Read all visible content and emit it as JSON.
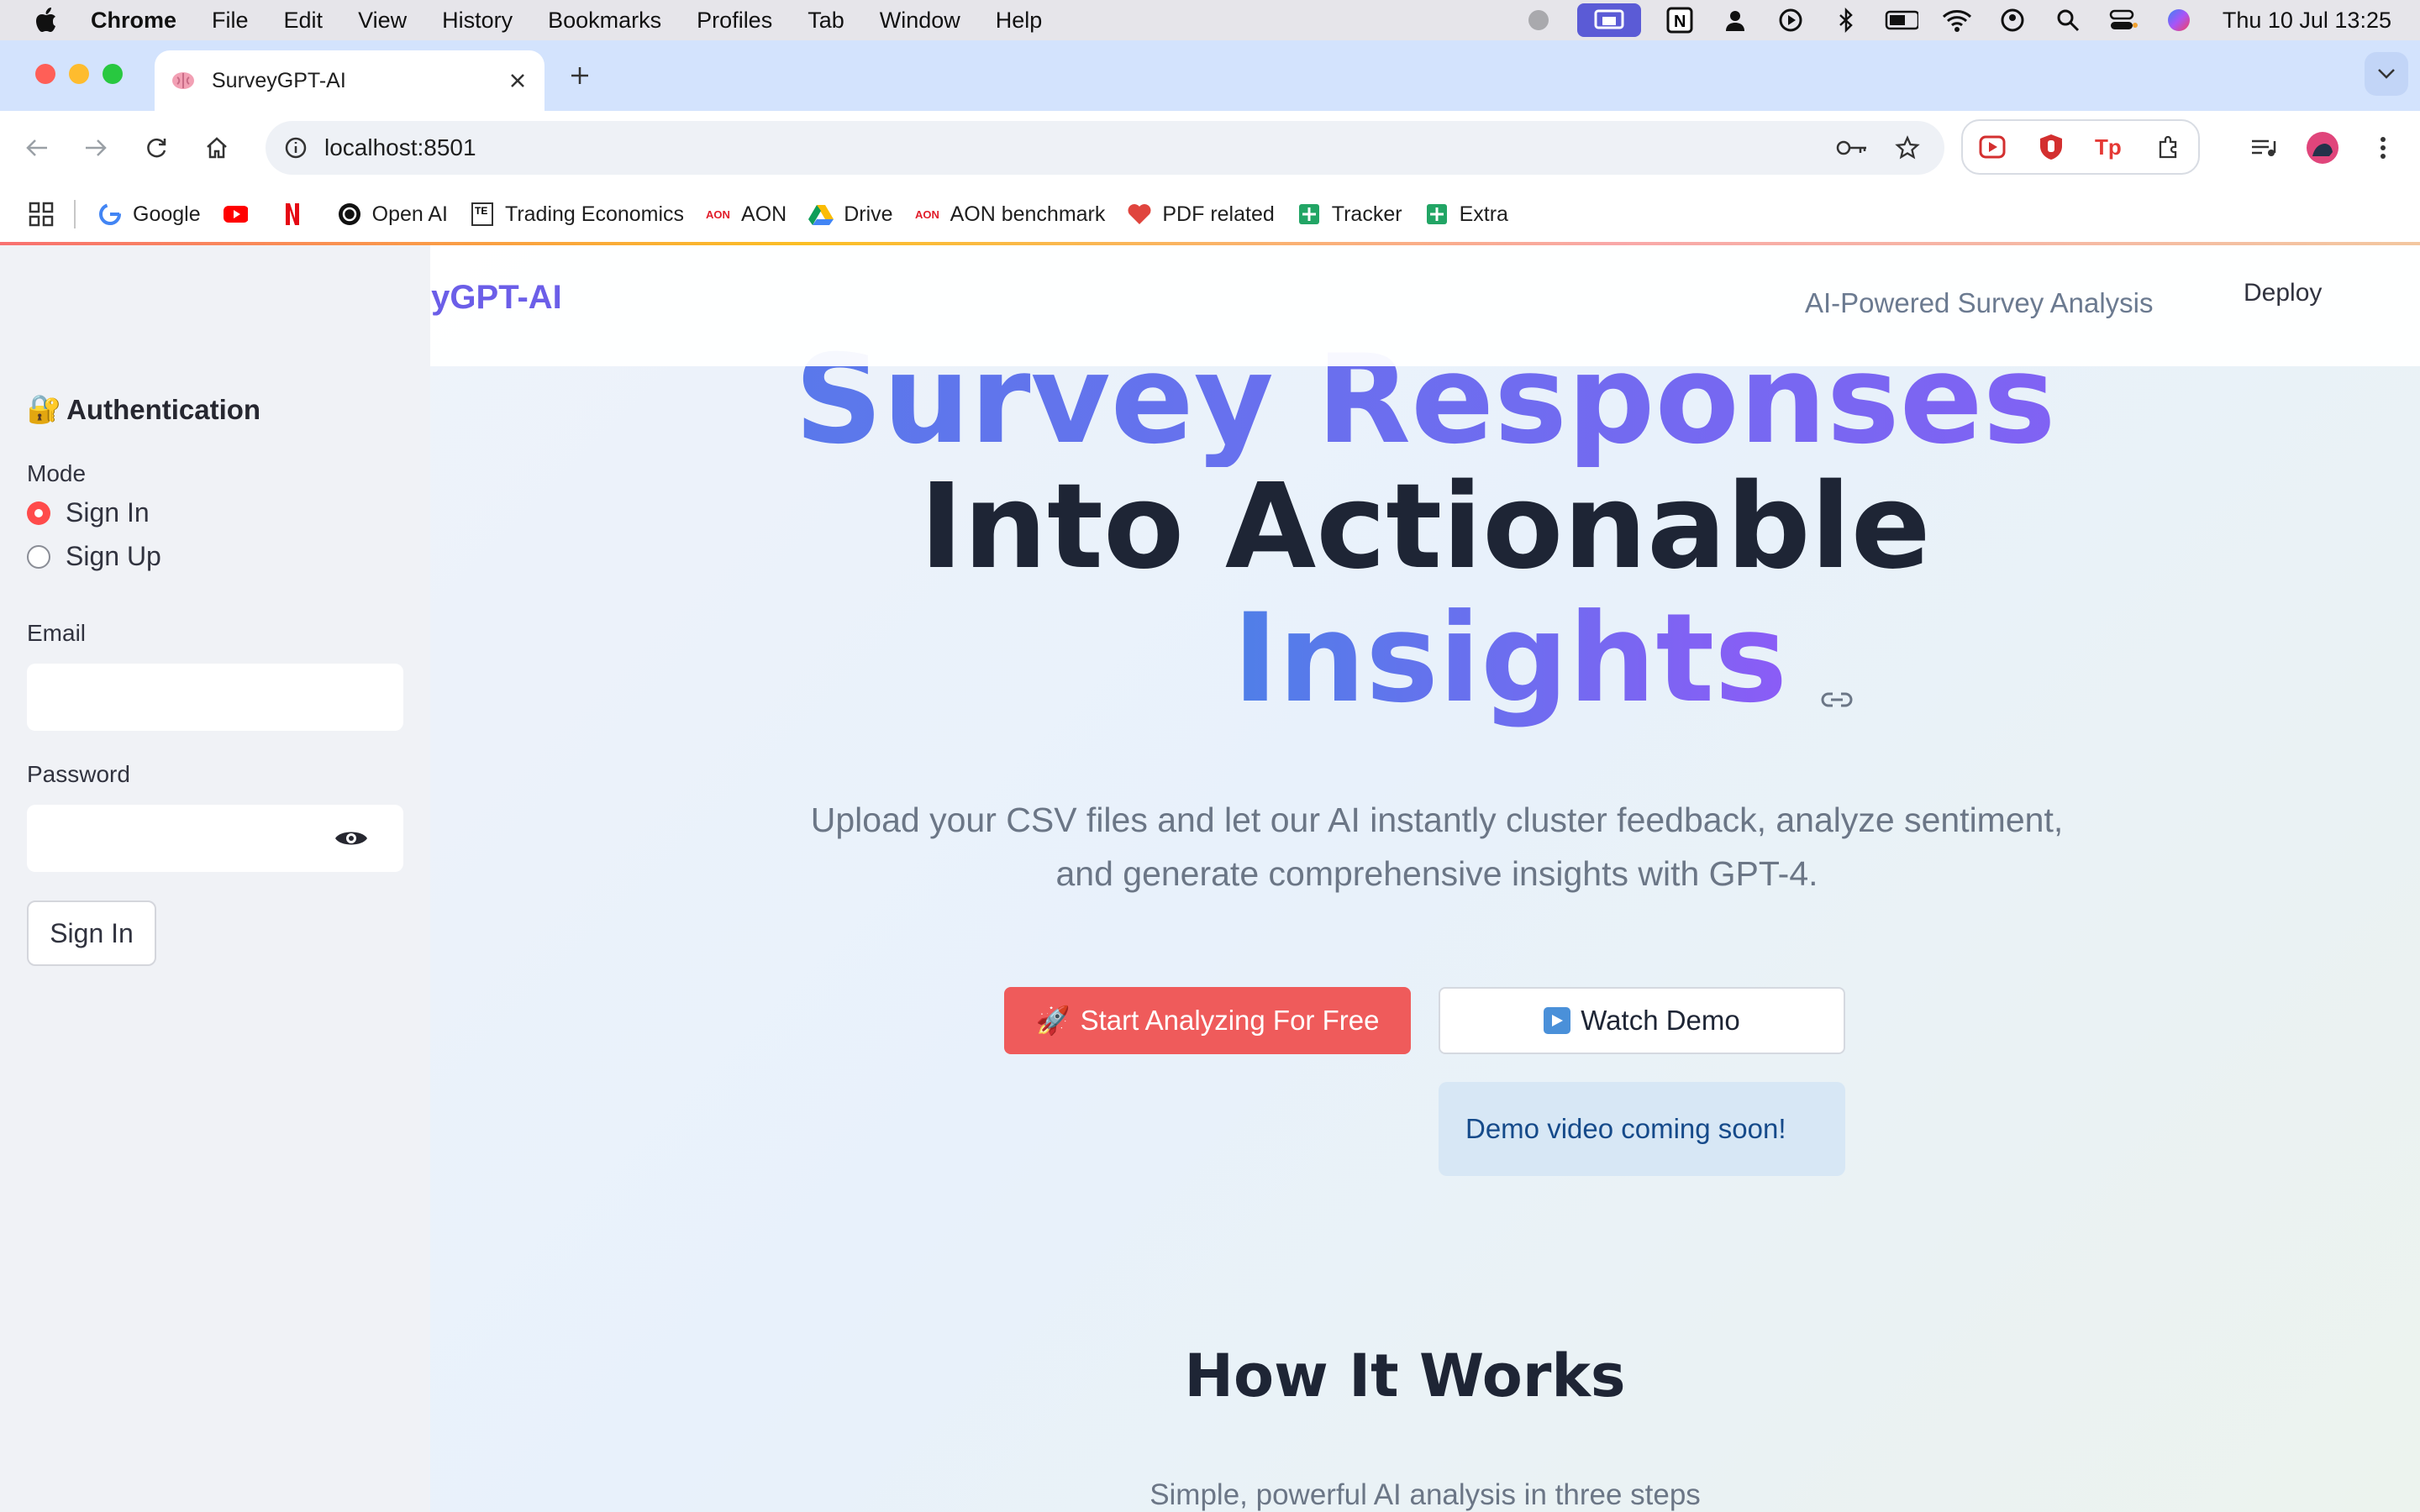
{
  "menubar": {
    "app": "Chrome",
    "items": [
      "File",
      "Edit",
      "View",
      "History",
      "Bookmarks",
      "Profiles",
      "Tab",
      "Window",
      "Help"
    ],
    "clock": "Thu 10 Jul  13:25"
  },
  "browser": {
    "tab_title": "SurveyGPT-AI",
    "url": "localhost:8501",
    "bookmarks": [
      "Google",
      "Open AI",
      "Trading Economics",
      "AON",
      "Drive",
      "AON benchmark",
      "PDF related",
      "Tracker",
      "Extra"
    ]
  },
  "sidebar": {
    "heading_icon": "🔐",
    "heading": "Authentication",
    "mode_label": "Mode",
    "mode_options": [
      "Sign In",
      "Sign Up"
    ],
    "mode_selected": "Sign In",
    "email_label": "Email",
    "email_value": "",
    "password_label": "Password",
    "password_value": "",
    "submit_label": "Sign In"
  },
  "header": {
    "brand": "SurveyGPT-AI",
    "tagline": "AI-Powered Survey Analysis",
    "deploy": "Deploy"
  },
  "hero": {
    "line1": "Survey Responses",
    "line2": "Into Actionable",
    "line3": "Insights",
    "subtitle": "Upload your CSV files and let our AI instantly cluster feedback, analyze sentiment, and generate comprehensive insights with GPT-4.",
    "primary_cta": "Start Analyzing For Free",
    "primary_cta_icon": "🚀",
    "secondary_cta": "Watch Demo",
    "info_message": "Demo video coming soon!"
  },
  "how_it_works": {
    "title": "How It Works",
    "subtitle": "Simple, powerful AI analysis in three steps"
  },
  "colors": {
    "accent": "#ef5b5b",
    "gradient_start": "#4f7fe8",
    "gradient_end": "#8b5cf6",
    "sidebar_bg": "#f0f2f6",
    "info_bg": "#d7e7f5"
  }
}
